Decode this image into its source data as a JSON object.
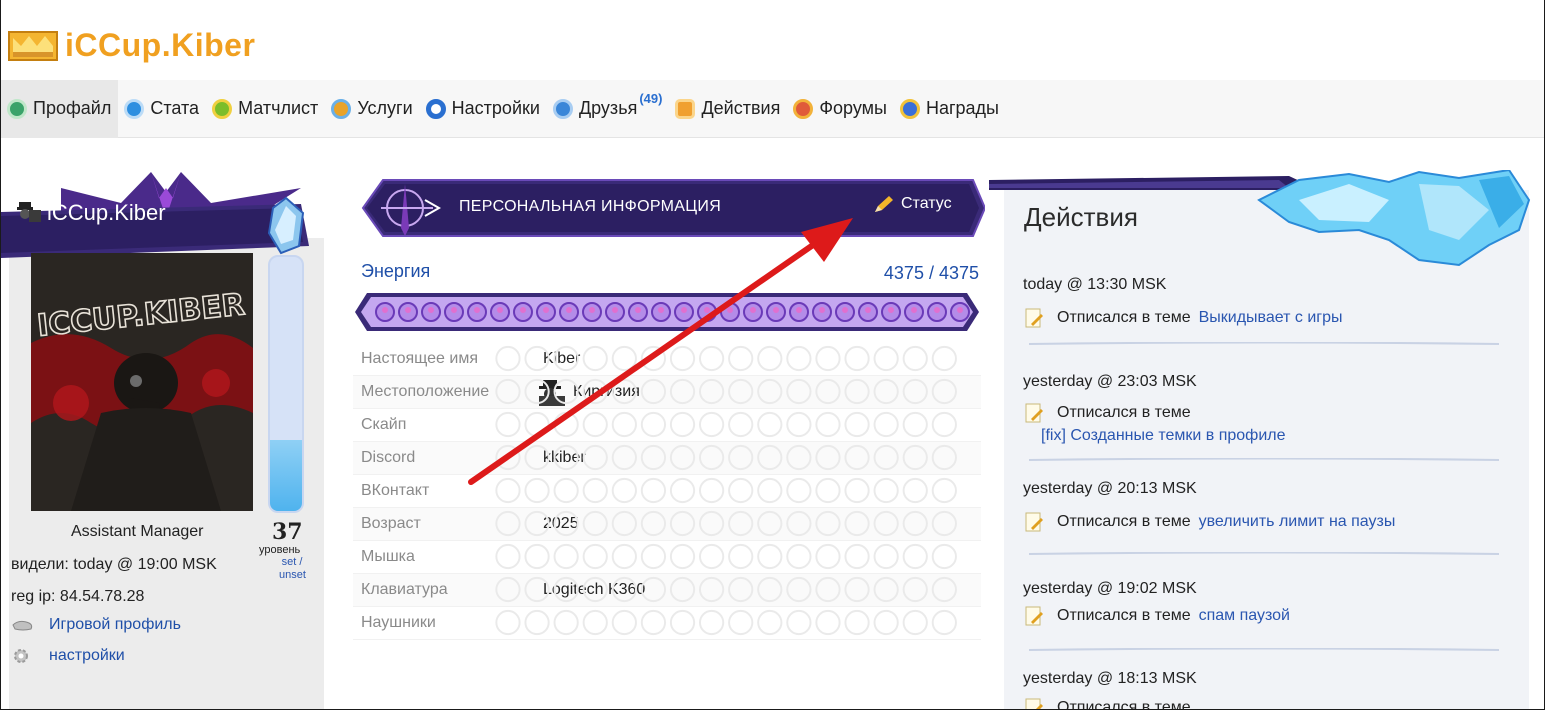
{
  "site": {
    "title": "iCCup.Kiber"
  },
  "nav": {
    "items": [
      {
        "label": "Профайл",
        "color": "#3aa36a"
      },
      {
        "label": "Стата",
        "color": "#2e8fe0"
      },
      {
        "label": "Матчлист",
        "color": "#7cbd2a"
      },
      {
        "label": "Услуги",
        "color": "#e8a32a"
      },
      {
        "label": "Настройки",
        "color": "#2a6fd0"
      },
      {
        "label": "Друзья",
        "color": "#3a86d8"
      },
      {
        "label": "Действия",
        "color": "#f0a030"
      },
      {
        "label": "Форумы",
        "color": "#e05a3a"
      },
      {
        "label": "Награды",
        "color": "#3a6fd8"
      }
    ],
    "friends_count": "(49)"
  },
  "profile": {
    "name": "iCCup.Kiber",
    "avatar_text": "ICCUP.KIBER",
    "rank": "Assistant Manager",
    "level": "37",
    "level_label": "уровень",
    "set_unset": "set / unset",
    "seen": "видели: today @ 19:00 MSK",
    "reg_ip": "reg ip: 84.54.78.28",
    "link_game_profile": "Игровой профиль",
    "link_settings": "настройки",
    "level_fill": 0.28
  },
  "info": {
    "title": "ПЕРСОНАЛЬНАЯ ИНФОРМАЦИЯ",
    "status_label": "Статус",
    "energy_label": "Энергия",
    "energy_value": "4375 / 4375",
    "energy_fill": 1.0,
    "rows": [
      {
        "k": "Настоящее имя",
        "v": "Kiber"
      },
      {
        "k": "Местоположение",
        "v": "Киргизия"
      },
      {
        "k": "Скайп",
        "v": ""
      },
      {
        "k": "Discord",
        "v": "kkiber"
      },
      {
        "k": "ВКонтакт",
        "v": ""
      },
      {
        "k": "Возраст",
        "v": "2025"
      },
      {
        "k": "Мышка",
        "v": ""
      },
      {
        "k": "Клавиатура",
        "v": "Logitech K360"
      },
      {
        "k": "Наушники",
        "v": ""
      }
    ]
  },
  "activity": {
    "title": "Действия",
    "entries": [
      {
        "time": "today @ 13:30 MSK",
        "action": "Отписался в теме",
        "topic": "Выкидывает с игры"
      },
      {
        "time": "yesterday @ 23:03 MSK",
        "action": "Отписался в теме",
        "topic": "[fix] Созданные темки в профиле"
      },
      {
        "time": "yesterday @ 20:13 MSK",
        "action": "Отписался в теме",
        "topic": "увеличить лимит на паузы"
      },
      {
        "time": "yesterday @ 19:02 MSK",
        "action": "Отписался в теме",
        "topic": "спам паузой"
      },
      {
        "time": "yesterday @ 18:13 MSK",
        "action": "Отписался в теме",
        "topic": ""
      }
    ]
  },
  "colors": {
    "accent": "#f0a020",
    "link": "#2a56b0",
    "ribbon": "#3a2a78",
    "arrow": "#dd1a1a"
  }
}
